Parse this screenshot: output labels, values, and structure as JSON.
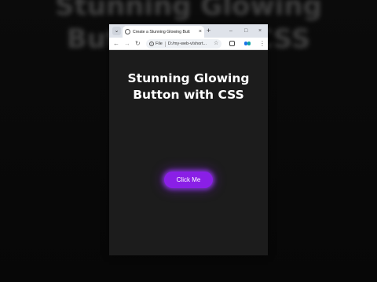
{
  "backdrop": {
    "line1": "Stunning Glowing",
    "line2": "Button with CSS"
  },
  "browser": {
    "tab_menu_icon": "chevron-down-icon",
    "tab": {
      "title": "Create a Stunning Glowing Butt",
      "close_label": "×"
    },
    "new_tab_label": "+",
    "window_controls": {
      "minimize": "–",
      "maximize": "□",
      "close": "×"
    },
    "toolbar": {
      "back": "←",
      "forward": "→",
      "reload": "↻",
      "scheme_label": "File",
      "url": "D:/my-web-v/short...",
      "bookmark": "☆",
      "menu": "⋮"
    },
    "colors": {
      "accent_blue": "#1a73e8",
      "accent_teal": "#0fa3a3"
    }
  },
  "page": {
    "heading_line1": "Stunning Glowing",
    "heading_line2": "Button with CSS",
    "button_label": "Click Me",
    "colors": {
      "background": "#1c1c1c",
      "button": "#8a1fe6",
      "glow": "#9b3cff"
    }
  }
}
